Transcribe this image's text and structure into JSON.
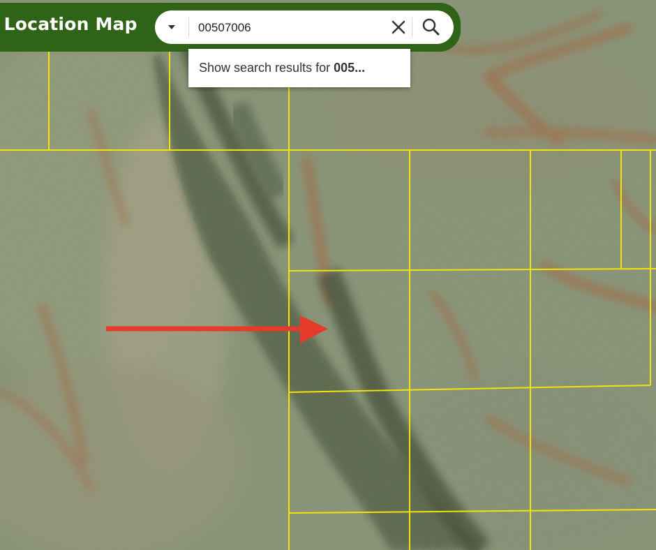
{
  "header": {
    "title": "l Location Map",
    "color": "#2f6317"
  },
  "search": {
    "value": "00507006",
    "dropdown_icon": "caret-down-icon",
    "clear_icon": "close-icon",
    "search_icon": "search-icon"
  },
  "suggestion": {
    "prefix": "Show search results for ",
    "query": "005..."
  },
  "map": {
    "type": "satellite imagery",
    "parcel_line_color": "#f2e30a",
    "arrow_color": "#e63a2a"
  }
}
